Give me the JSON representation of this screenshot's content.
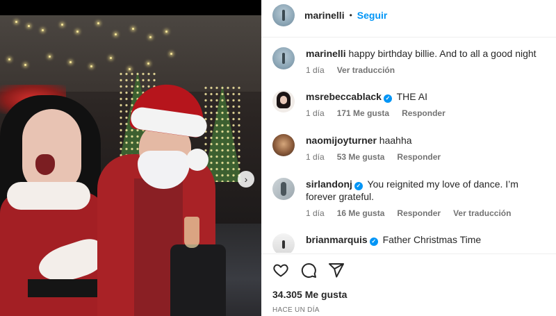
{
  "post": {
    "author": "marinelli",
    "follow_label": "Seguir",
    "separator": "•",
    "likes_text": "34.305 Me gusta",
    "time_text": "HACE UN DÍA",
    "next_glyph": "›"
  },
  "comments": [
    {
      "user": "marinelli",
      "verified": false,
      "text": "happy birthday billie. And to all a good night",
      "time": "1 día",
      "likes": "",
      "reply": "",
      "translate": "Ver traducción"
    },
    {
      "user": "msrebeccablack",
      "verified": true,
      "text": "THE AI",
      "time": "1 día",
      "likes": "171 Me gusta",
      "reply": "Responder",
      "translate": ""
    },
    {
      "user": "naomijoyturner",
      "verified": false,
      "text": "haahha",
      "time": "1 día",
      "likes": "53 Me gusta",
      "reply": "Responder",
      "translate": ""
    },
    {
      "user": "sirlandonj",
      "verified": true,
      "text": "You reignited my love of dance. I’m forever grateful.",
      "time": "1 día",
      "likes": "16 Me gusta",
      "reply": "Responder",
      "translate": "Ver traducción"
    },
    {
      "user": "brianmarquis",
      "verified": true,
      "text": "Father Christmas Time",
      "time": "",
      "likes": "",
      "reply": "",
      "translate": ""
    }
  ],
  "icons": {
    "like": "heart-icon",
    "comment": "comment-bubble-icon",
    "share": "paper-plane-icon",
    "verified": "verified-badge-icon",
    "verified_glyph": "✓"
  },
  "colors": {
    "accent": "#0095f6",
    "text": "#262626",
    "muted": "#737373",
    "divider": "#efefef"
  }
}
